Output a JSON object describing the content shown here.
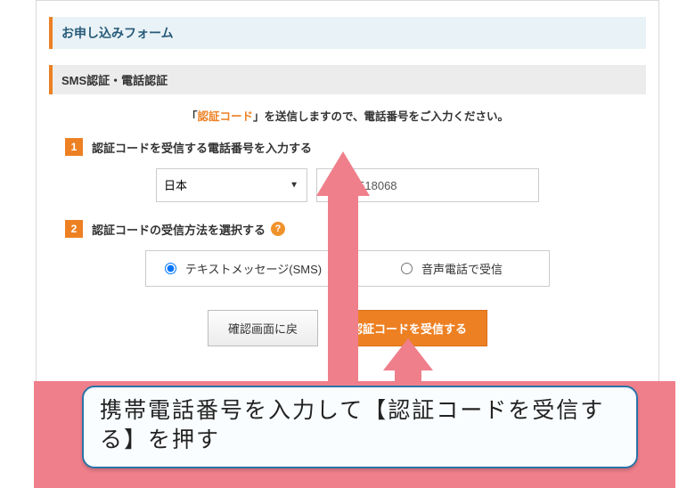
{
  "page_title": "お申し込みフォーム",
  "section_title": "SMS認証・電話認証",
  "instruction_prefix": "「",
  "instruction_keyword": "認証コード",
  "instruction_suffix": "」を送信しますので、電話番号をご入力ください。",
  "step1": {
    "num": "1",
    "label": "認証コードを受信する電話番号を入力する"
  },
  "step2": {
    "num": "2",
    "label": "認証コードの受信方法を選択する"
  },
  "help_icon": "?",
  "country": {
    "selected": "日本"
  },
  "phone": {
    "value": "09082518068"
  },
  "radio_sms": "テキストメッセージ(SMS)",
  "radio_voice": "音声電話で受信",
  "btn_back": "確認画面に戻",
  "btn_submit": "認証コードを受信する",
  "callout_text": "携帯電話番号を入力して【認証コードを受信する】を押す"
}
